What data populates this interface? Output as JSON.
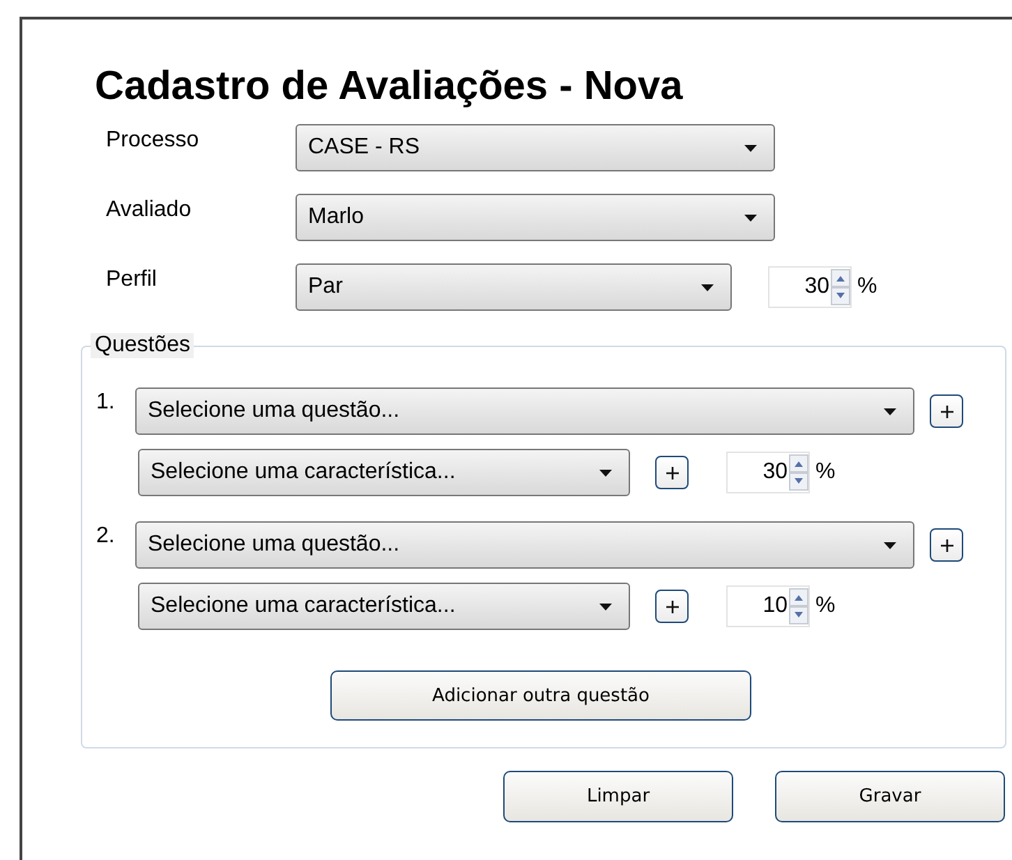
{
  "title": "Cadastro de Avaliações - Nova",
  "fields": [
    {
      "label": "Processo",
      "value": "CASE - RS",
      "kind": "select"
    },
    {
      "label": "Avaliado",
      "value": "Marlo",
      "kind": "select"
    },
    {
      "label": "Perfil",
      "value": "Par",
      "kind": "select_percent",
      "percent": "30",
      "unit": "%"
    }
  ],
  "questions_section": {
    "legend": "Questões",
    "questions": [
      {
        "number": "1.",
        "question": "Selecione uma questão...",
        "characteristic": "Selecione uma característica...",
        "percent": "30",
        "unit": "%"
      },
      {
        "number": "2.",
        "question": "Selecione uma questão...",
        "characteristic": "Selecione uma característica...",
        "percent": "10",
        "unit": "%"
      }
    ],
    "add_button": "Adicionar outra questão"
  },
  "buttons": [
    "Limpar",
    "Gravar"
  ]
}
